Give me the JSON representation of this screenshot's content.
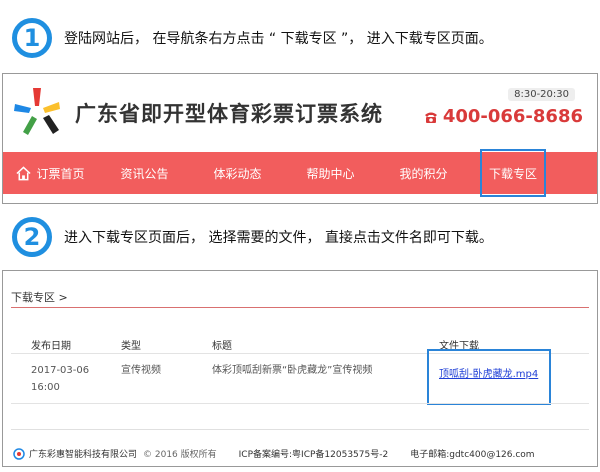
{
  "steps": [
    {
      "number": "1",
      "text": "登陆网站后， 在导航条右方点击 “ 下载专区 ”， 进入下载专区页面。"
    },
    {
      "number": "2",
      "text": "进入下载专区页面后， 选择需要的文件， 直接点击文件名即可下载。"
    }
  ],
  "site": {
    "title": "广东省即开型体育彩票订票系统",
    "hours": "8:30-20:30",
    "hotline": "400-066-8686"
  },
  "nav": {
    "home": "订票首页",
    "news": "资讯公告",
    "sports": "体彩动态",
    "help": "帮助中心",
    "points": "我的积分",
    "download": "下载专区"
  },
  "download_page": {
    "breadcrumb": "下载专区 >",
    "columns": [
      "发布日期",
      "类型",
      "标题",
      "文件下载"
    ],
    "rows": [
      {
        "date": "2017-03-06",
        "time": "16:00",
        "type": "宣传视频",
        "title": "体彩顶呱刮新票“卧虎藏龙”宣传视频",
        "file": "顶呱刮-卧虎藏龙.mp4"
      }
    ]
  },
  "footer": {
    "company": "广东彩惠智能科技有限公司",
    "copyright": "© 2016 版权所有",
    "icp": "ICP备案编号:粤ICP备12053575号-2",
    "email": "电子邮箱:gdtc400@126.com"
  },
  "colors": {
    "nav_bg": "#f25d5d",
    "highlight": "#2a84d8",
    "step_blue": "#1f8fe0",
    "hotline_red": "#d93a3a",
    "link_blue": "#1f3fd6"
  }
}
